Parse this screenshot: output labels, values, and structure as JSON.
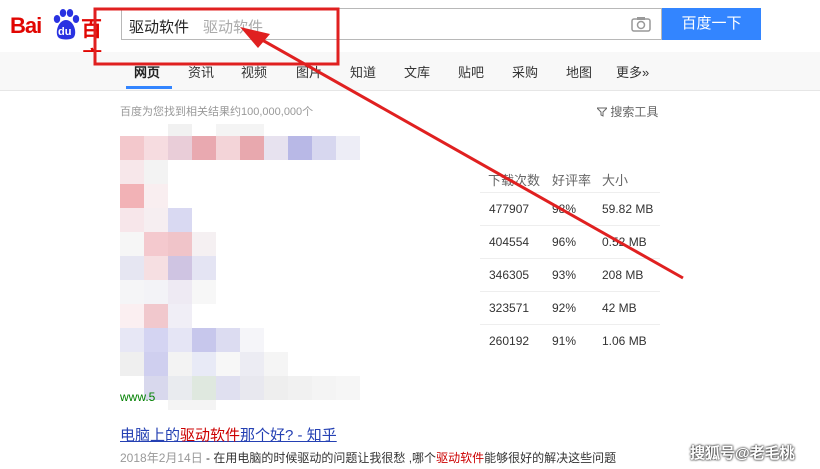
{
  "logo": {
    "text_bai": "Bai",
    "text_du": "du",
    "text_baidu": "百度"
  },
  "search": {
    "value": "驱动软件",
    "suggestion": "驱动软件",
    "button_label": "百度一下"
  },
  "nav": {
    "tabs": [
      {
        "label": "网页"
      },
      {
        "label": "资讯"
      },
      {
        "label": "视频"
      },
      {
        "label": "图片"
      },
      {
        "label": "知道"
      },
      {
        "label": "文库"
      },
      {
        "label": "贴吧"
      },
      {
        "label": "采购"
      },
      {
        "label": "地图"
      },
      {
        "label": "更多»"
      }
    ]
  },
  "results": {
    "count_text": "百度为您找到相关结果约100,000,000个",
    "tools_label": "搜索工具"
  },
  "table": {
    "headers": [
      "下载次数",
      "好评率",
      "大小"
    ],
    "rows": [
      [
        "477907",
        "98%",
        "59.82 MB"
      ],
      [
        "404554",
        "96%",
        "0.52 MB"
      ],
      [
        "346305",
        "93%",
        "208 MB"
      ],
      [
        "323571",
        "92%",
        "42 MB"
      ],
      [
        "260192",
        "91%",
        "1.06 MB"
      ]
    ]
  },
  "result2": {
    "url_fragment": "www.5",
    "title_prefix": "电脑上的",
    "title_em": "驱动软件",
    "title_suffix": "那个好? - 知乎",
    "date": "2018年2月14日",
    "snippet_prefix": " - 在用电脑的时候驱动的问题让我很愁 ,哪个",
    "snippet_em": "驱动软件",
    "snippet_suffix": "能够很好的解决这些问题"
  },
  "watermark": {
    "text": "搜狐号@老毛桃"
  },
  "colors": {
    "brand_red": "#e10602",
    "button_blue": "#3385ff",
    "annotation_red": "#e02020"
  }
}
